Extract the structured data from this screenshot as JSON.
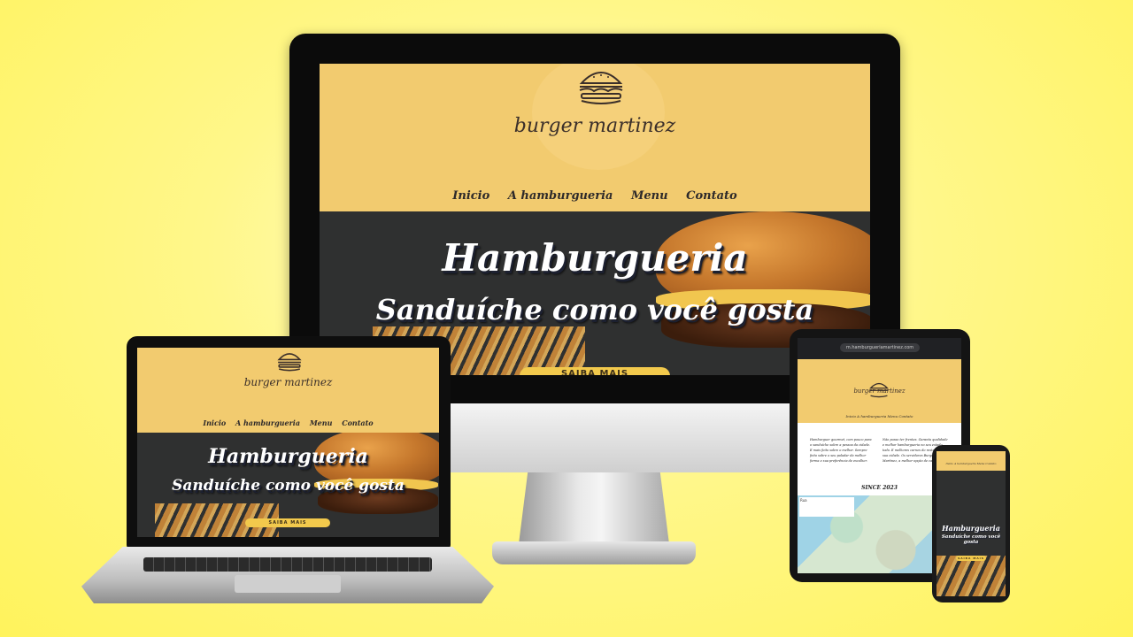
{
  "brand": "burger martinez",
  "nav": [
    "Inicio",
    "A hamburgueria",
    "Menu",
    "Contato"
  ],
  "hero": {
    "title": "Hamburgueria",
    "subtitle": "Sanduíche como você gosta",
    "button": "SAIBA MAIS"
  },
  "tablet": {
    "url": "m.hamburgueriamartinez.com",
    "nav_line": "Inicio  A hamburgueria  Menu  Contato",
    "text_left": "Hamburguer gourmet, com pouco para o sanduíche sobre a pessoa da cidade. E mais feito sobre o melhor. Sempre feito sobre o seu paladar da melhor forma e sua preferência de escolher.",
    "text_right": "Não posso ter frentes. Garanta qualidade e melhor hamburgueria no seu estado todo. E melhores carnes do restaurante na sua cidade. Os servidores Burger Martinez, a melhor opção de carne.",
    "since": "SINCE 2023",
    "map_label": "Rua"
  },
  "colors": {
    "background": "#fff35c",
    "header_yellow": "#f2cb6f",
    "button_yellow": "#f2c94c",
    "hero_dark": "#2f3030"
  }
}
